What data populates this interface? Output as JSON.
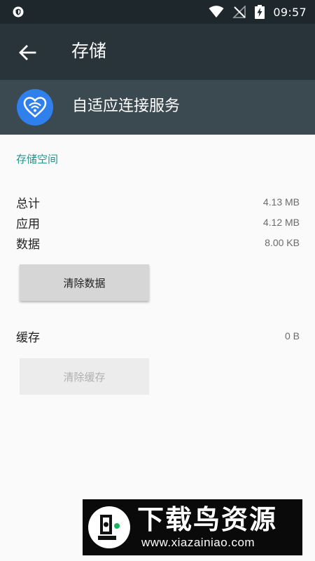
{
  "status_bar": {
    "time": "09:57"
  },
  "app_bar": {
    "title": "存储"
  },
  "app_header": {
    "app_name": "自适应连接服务"
  },
  "storage": {
    "section_title": "存储空间",
    "rows": [
      {
        "label": "总计",
        "value": "4.13 MB"
      },
      {
        "label": "应用",
        "value": "4.12 MB"
      },
      {
        "label": "数据",
        "value": "8.00 KB"
      }
    ],
    "clear_data_label": "清除数据"
  },
  "cache": {
    "label": "缓存",
    "value": "0 B",
    "clear_cache_label": "清除缓存"
  },
  "watermark": {
    "title": "下载鸟资源",
    "url": "www.xiazainiao.com"
  },
  "colors": {
    "status_bar": "#1e272b",
    "app_bar": "#28343a",
    "app_header": "#3b4950",
    "accent": "#24958a",
    "app_icon": "#2f80ed"
  }
}
